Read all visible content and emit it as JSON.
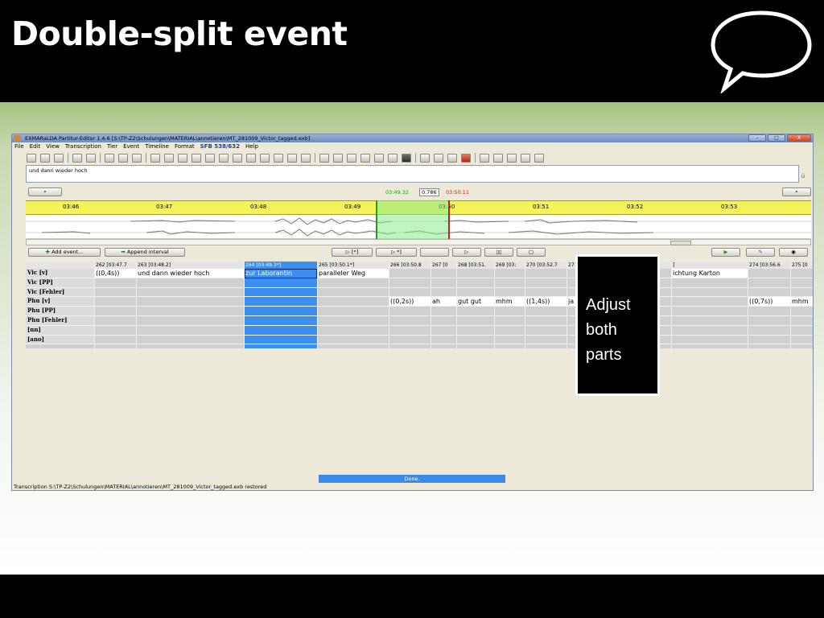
{
  "slide": {
    "title": "Double-split event",
    "callout_text": "Adjust both parts"
  },
  "app": {
    "window_title": "EXMARaLDA Partitur-Editor 1.4.6 [S:\\TP-Z2\\Schulungen\\MATERIAL\\annotieren\\MT_281009_Victor_tagged.exb]",
    "window_buttons": [
      "–",
      "□",
      "X"
    ],
    "menu": [
      "File",
      "Edit",
      "View",
      "Transcription",
      "Tier",
      "Event",
      "Timeline",
      "Format",
      "SFB 538/632",
      "Help"
    ],
    "edit_text": "und dann wieder hoch",
    "time_start": "03:49.32",
    "time_length": "0.786",
    "time_end": "03:50.11",
    "ruler_labels": [
      "03:46",
      "03:47",
      "03:48",
      "03:49",
      "03:50",
      "03:51",
      "03:52",
      "03:53"
    ],
    "add_event_label": "Add event...",
    "append_interval_label": "Append interval",
    "play_buttons": [
      "▷ [*]",
      "▷ *]",
      "",
      "▷",
      "▯▯",
      "▢"
    ],
    "scroll_thumb_label": "III",
    "status_text": "Transcription S:\\TP-Z2\\Schulungen\\MATERIAL\\annotieren\\MT_281009_Victor_tagged.exb restored",
    "progress_text": "Done.",
    "colors": {
      "selection": "#3a8ff0",
      "ruler": "#f5f25a",
      "start_marker": "#18a018",
      "end_marker": "#c02020"
    }
  },
  "partitur": {
    "tiers": [
      "Vic [v]",
      "Vic [PP]",
      "Vic [Fehler]",
      "Phu [v]",
      "Phu [PP]",
      "Phu [Fehler]",
      "[nn]",
      "[ano]"
    ],
    "columns": [
      {
        "header": "262 [03:47.7",
        "vic": "((0,4s))",
        "phu": ""
      },
      {
        "header": "263 [03:48.2]",
        "vic": "und dann wieder hoch",
        "phu": ""
      },
      {
        "header": "264 [03:49.3*]",
        "vic": "zur Laborantin",
        "phu": ""
      },
      {
        "header": "265 [03:50.1*]",
        "vic": "paralleler Weg",
        "phu": ""
      },
      {
        "header": "266 [03:50.8",
        "vic": "",
        "phu": "((0,2s))"
      },
      {
        "header": "267 [0",
        "vic": "",
        "phu": "ah"
      },
      {
        "header": "268 [03:51.",
        "vic": "",
        "phu": "gut gut"
      },
      {
        "header": "269 [03:",
        "vic": "",
        "phu": "mhm"
      },
      {
        "header": "270 [03:52.7",
        "vic": "",
        "phu": "((1,4s))"
      },
      {
        "header": "271 [",
        "vic": "",
        "phu": "ja"
      },
      {
        "header": "",
        "vic": "",
        "phu": ""
      },
      {
        "header": "]",
        "vic": "ichtung Karton",
        "phu": ""
      },
      {
        "header": "274 [03:56.6",
        "vic": "",
        "phu": "((0,7s))"
      },
      {
        "header": "275 [0",
        "vic": "",
        "phu": "mhm"
      }
    ]
  }
}
